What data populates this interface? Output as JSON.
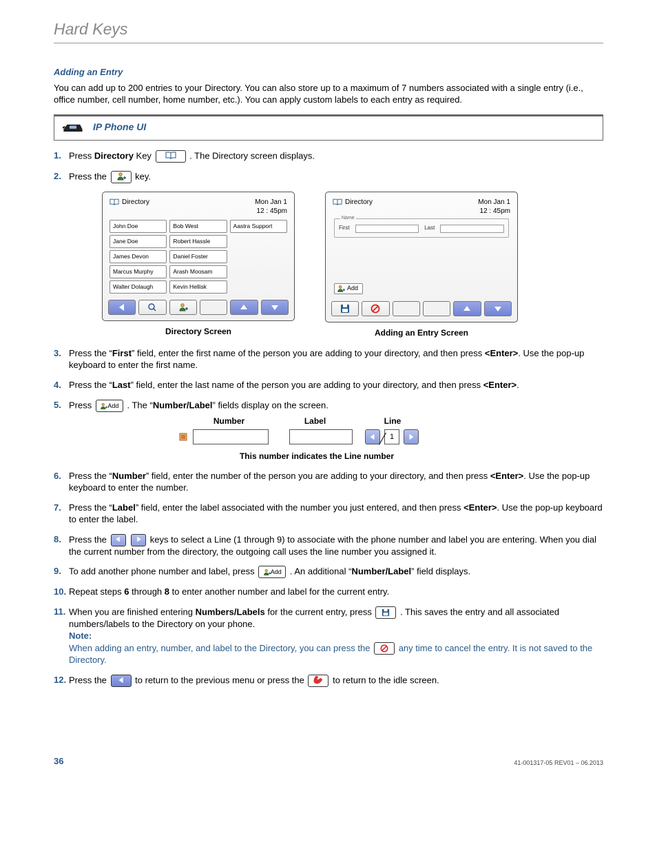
{
  "page_title": "Hard Keys",
  "section_heading": "Adding an Entry",
  "intro_text": "You can add up to 200 entries to your Directory. You can also store up to a maximum of 7 numbers associated with a single entry (i.e., office number, cell number, home number, etc.). You can apply custom labels to each entry as required.",
  "ipui_label": "IP Phone UI",
  "steps": {
    "s1_a": "Press ",
    "s1_b": "Directory",
    "s1_c": " Key ",
    "s1_d": ". The Directory screen displays.",
    "s2_a": "Press the ",
    "s2_b": " key.",
    "s3": "Press the “First” field, enter the first name of the person you are adding to your directory, and then press <Enter>. Use the pop-up keyboard to enter the first name.",
    "s3_plain_a": "Press the “",
    "s3_bold_a": "First",
    "s3_plain_b": "” field, enter the first name of the person you are adding to your directory, and then press ",
    "s3_bold_b": "<Enter>",
    "s3_plain_c": ". Use the pop-up keyboard to enter the first name.",
    "s4_plain_a": "Press the “",
    "s4_bold_a": "Last",
    "s4_plain_b": "” field, enter the last name of the person you are adding to your directory, and then press ",
    "s4_bold_b": "<Enter>",
    "s4_plain_c": ".",
    "s5_a": "Press ",
    "s5_b": ". The “",
    "s5_bold": "Number/Label",
    "s5_c": "” fields display on the screen.",
    "s6_a": "Press the “",
    "s6_bold_a": "Number",
    "s6_b": "” field, enter the number of the person you are adding to your directory, and then press ",
    "s6_bold_b": "<Enter>",
    "s6_c": ". Use the pop-up keyboard to enter the number.",
    "s7_a": "Press the “",
    "s7_bold_a": "Label",
    "s7_b": "” field, enter the label associated with the number you just entered, and then press ",
    "s7_bold_b": "<Enter>",
    "s7_c": ". Use the pop-up keyboard to enter the label.",
    "s8_a": "Press the ",
    "s8_b": " keys to select a Line (1 through 9) to associate with the phone number and label you are entering. When you dial the current number from the directory, the outgoing call uses the line number you assigned it.",
    "s9_a": "To add another phone number and label, press ",
    "s9_b": ". An additional “",
    "s9_bold": "Number/Label",
    "s9_c": "” field displays.",
    "s10_a": "Repeat steps ",
    "s10_bold_a": "6",
    "s10_b": " through ",
    "s10_bold_b": "8",
    "s10_c": " to enter another number and label for the current entry.",
    "s11_a": "When you are finished entering ",
    "s11_bold": "Numbers/Labels",
    "s11_b": " for the current entry, press ",
    "s11_c": " . This saves the entry and all associated numbers/labels to the Directory on your phone.",
    "s11_note_label": "Note:",
    "s11_note_a": "When adding an entry, number, and label to the Directory, you can press the ",
    "s11_note_b": " any time to cancel the entry. It is not saved to the Directory.",
    "s12_a": "Press the ",
    "s12_b": " to return to the previous menu or press the ",
    "s12_c": " to return to the idle screen."
  },
  "screen_a": {
    "title": "Directory",
    "date": "Mon Jan 1",
    "time": "12 : 45pm",
    "cells": [
      "John Doe",
      "Bob West",
      "Aastra Support",
      "Jane Doe",
      "Robert Hassle",
      "",
      "James Devon",
      "Daniel Foster",
      "",
      "Marcus Murphy",
      "Arash Moosam",
      "",
      "Walter Dolaugh",
      "Kevin Hellisk",
      ""
    ],
    "caption": "Directory Screen"
  },
  "screen_b": {
    "title": "Directory",
    "date": "Mon Jan 1",
    "time": "12 : 45pm",
    "fieldset_legend": "Name",
    "first_label": "First",
    "last_label": "Last",
    "add_label": "Add",
    "caption": "Adding an Entry Screen"
  },
  "nll": {
    "h1": "Number",
    "h2": "Label",
    "h3": "Line",
    "line_value": "1",
    "note": "This number indicates the Line number"
  },
  "add_key_label": "Add",
  "footer": {
    "page": "36",
    "rev": "41-001317-05 REV01 – 06.2013"
  }
}
